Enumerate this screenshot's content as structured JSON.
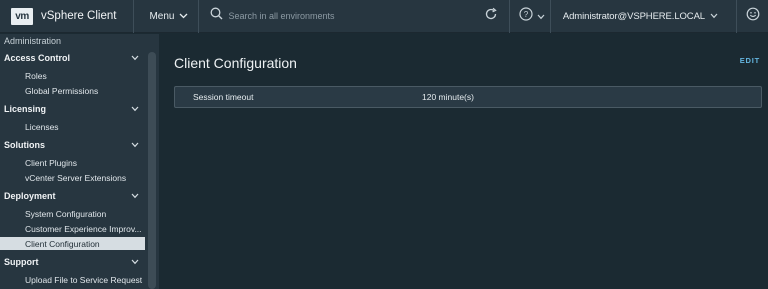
{
  "header": {
    "logo": "vm",
    "app_title": "vSphere Client",
    "menu_label": "Menu",
    "search_placeholder": "Search in all environments",
    "user": "Administrator@VSPHERE.LOCAL",
    "icons": [
      "search-icon",
      "refresh-icon",
      "help-icon",
      "chevron-down-icon",
      "feedback-icon"
    ]
  },
  "sidebar": {
    "breadcrumb": "Administration",
    "groups": [
      {
        "label": "Access Control",
        "items": [
          "Roles",
          "Global Permissions"
        ]
      },
      {
        "label": "Licensing",
        "items": [
          "Licenses"
        ]
      },
      {
        "label": "Solutions",
        "items": [
          "Client Plugins",
          "vCenter Server Extensions"
        ]
      },
      {
        "label": "Deployment",
        "items": [
          "System Configuration",
          "Customer Experience Improv...",
          "Client Configuration"
        ]
      },
      {
        "label": "Support",
        "items": [
          "Upload File to Service Request"
        ]
      }
    ],
    "active_item": "Client Configuration"
  },
  "main": {
    "title": "Client Configuration",
    "edit_label": "EDIT",
    "rows": [
      {
        "key": "Session timeout",
        "value": "120 minute(s)"
      }
    ]
  },
  "colors": {
    "header_bg": "#273640",
    "content_bg": "#1b2a32",
    "active_item_bg": "#d6dde2",
    "link": "#64b5df"
  }
}
